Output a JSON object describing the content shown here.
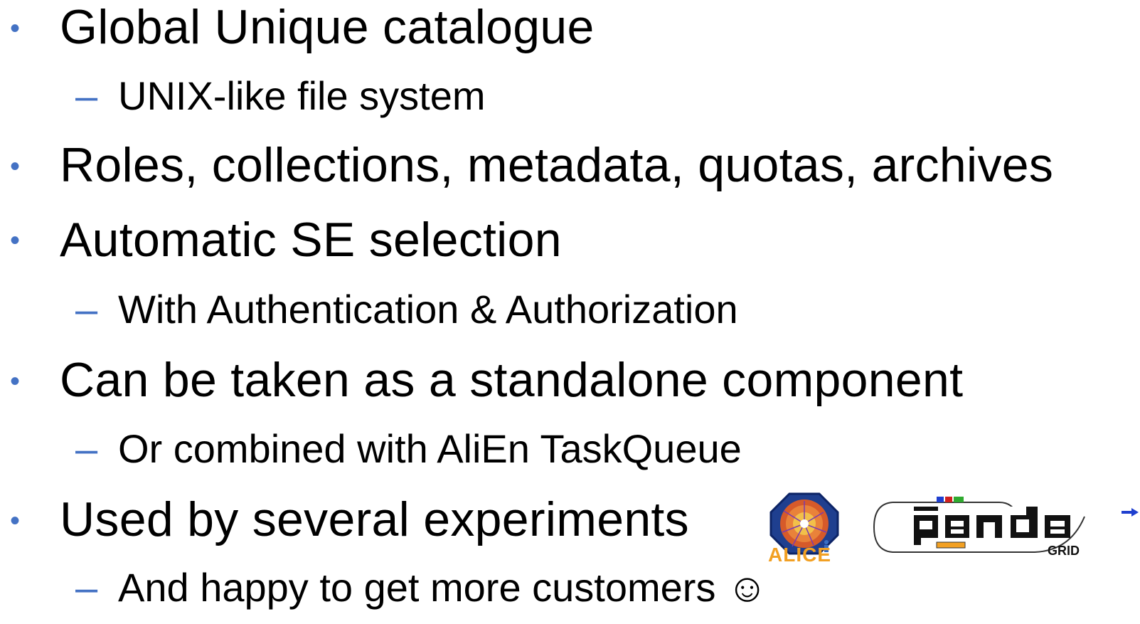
{
  "bullets": [
    {
      "text": "Global Unique catalogue",
      "sub": [
        "UNIX-like file system"
      ]
    },
    {
      "text": "Roles, collections, metadata, quotas, archives",
      "sub": []
    },
    {
      "text": "Automatic SE selection",
      "sub": [
        "With Authentication & Authorization"
      ]
    },
    {
      "text": "Can be taken as a standalone component",
      "sub": [
        "Or combined with AliEn TaskQueue"
      ]
    },
    {
      "text": "Used by several experiments",
      "sub": [
        "And happy to get more customers ☺"
      ]
    }
  ],
  "bullet_glyph": "•",
  "dash_glyph": "–",
  "logos": {
    "alice": "ALICE",
    "panda_sub": "GRID"
  },
  "colors": {
    "bullet": "#4472c4",
    "alice_orange": "#f2a023"
  }
}
